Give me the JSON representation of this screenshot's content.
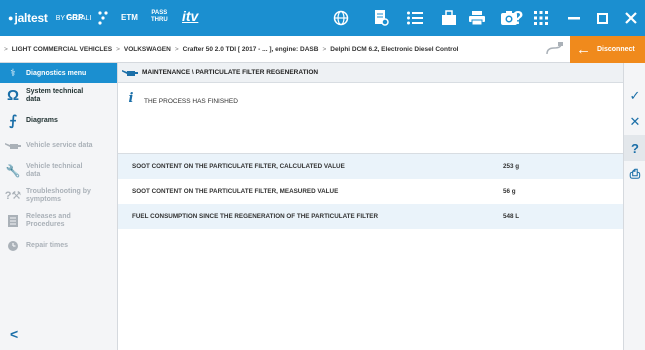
{
  "topbar": {
    "brand_main": "jaltest",
    "brand_sub": "BY COJALI",
    "grp": "GRP",
    "etm": "ETM",
    "pass_line1": "PASS",
    "pass_line2": "THRU",
    "itv": "itv",
    "help": "?",
    "colors": {
      "bar": "#1b8fd0",
      "accent": "#f08a1c"
    }
  },
  "breadcrumb": {
    "parts": [
      "LIGHT COMMERCIAL VEHICLES",
      "VOLKSWAGEN",
      "Crafter 50 2.0 TDI [ 2017 - ... ], engine: DASB",
      "Delphi DCM 6.2, Electronic Diesel Control"
    ],
    "separator": ">",
    "disconnect_label": "Disconnect"
  },
  "sidebar": {
    "header": "Diagnostics menu",
    "items": [
      {
        "line1": "System technical",
        "line2": "data",
        "icon": "omega-icon",
        "enabled": true
      },
      {
        "line1": "Diagrams",
        "line2": "",
        "icon": "diagram-icon",
        "enabled": true
      },
      {
        "line1": "Vehicle service data",
        "line2": "",
        "icon": "oil-can-icon",
        "enabled": false
      },
      {
        "line1": "Vehicle technical",
        "line2": "data",
        "icon": "wrench-icon",
        "enabled": false
      },
      {
        "line1": "Troubleshooting by",
        "line2": "symptoms",
        "icon": "troubleshoot-icon",
        "enabled": false
      },
      {
        "line1": "Releases and",
        "line2": "Procedures",
        "icon": "document-icon",
        "enabled": false
      },
      {
        "line1": "Repair times",
        "line2": "",
        "icon": "clock-gear-icon",
        "enabled": false
      }
    ]
  },
  "main": {
    "title": "MAINTENANCE \\ PARTICULATE FILTER REGENERATION",
    "message": "THE PROCESS HAS FINISHED",
    "rows": [
      {
        "name": "SOOT CONTENT ON THE PARTICULATE FILTER, CALCULATED VALUE",
        "value": "253 g"
      },
      {
        "name": "SOOT CONTENT ON THE PARTICULATE FILTER, MEASURED VALUE",
        "value": "56 g"
      },
      {
        "name": "FUEL CONSUMPTION SINCE THE REGENERATION OF THE PARTICULATE FILTER",
        "value": "548 L"
      }
    ]
  },
  "rightbar": {
    "confirm": "✓",
    "cancel": "✕",
    "help": "?",
    "print": "⎙"
  }
}
